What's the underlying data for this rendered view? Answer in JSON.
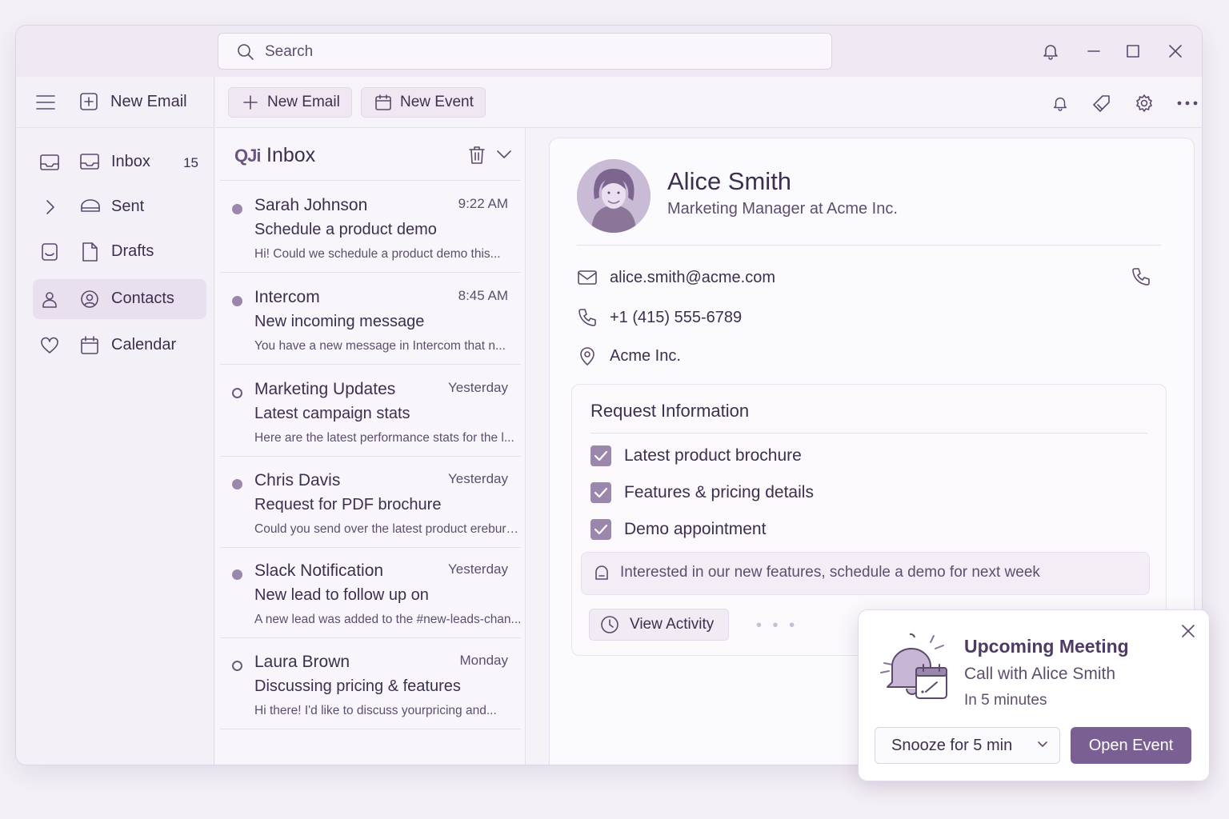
{
  "search": {
    "placeholder": "Search"
  },
  "sidebar": {
    "new_email_label": "New Email",
    "items": [
      {
        "label": "Inbox",
        "count": "15"
      },
      {
        "label": "Sent"
      },
      {
        "label": "Drafts"
      },
      {
        "label": "Contacts"
      },
      {
        "label": "Calendar"
      }
    ]
  },
  "toolbar": {
    "new_email_label": "New Email",
    "new_event_label": "New Event"
  },
  "inbox": {
    "logo": "QJi",
    "title": "Inbox",
    "emails": [
      {
        "sender": "Sarah Johnson",
        "time": "9:22 AM",
        "subject": "Schedule a product demo",
        "preview": "Hi! Could we schedule a product demo this..."
      },
      {
        "sender": "Intercom",
        "time": "8:45 AM",
        "subject": "New incoming message",
        "preview": "You have a new message in Intercom that n..."
      },
      {
        "sender": "Marketing Updates",
        "time": "Yesterday",
        "subject": "Latest campaign stats",
        "preview": "Here are the latest performance stats for the l..."
      },
      {
        "sender": "Chris Davis",
        "time": "Yesterday",
        "subject": "Request for PDF brochure",
        "preview": "Could you send over the latest product erebure..."
      },
      {
        "sender": "Slack Notification",
        "time": "Yesterday",
        "subject": "New lead to follow up on",
        "preview": "A new lead was added to the #new-leads-chan..."
      },
      {
        "sender": "Laura Brown",
        "time": "Monday",
        "subject": "Discussing pricing & features",
        "preview": "Hi there! I'd like to discuss yourpricing and..."
      }
    ]
  },
  "contact": {
    "name": "Alice Smith",
    "role": "Marketing Manager at Acme Inc.",
    "email": "alice.smith@acme.com",
    "phone": "+1 (415) 555-6789",
    "company": "Acme Inc."
  },
  "request": {
    "title": "Request Information",
    "items": [
      "Latest product brochure",
      "Features & pricing details",
      "Demo appointment"
    ],
    "note": "Interested in our new features, schedule a demo for next week",
    "view_activity_label": "View Activity",
    "more": "• • •"
  },
  "notification": {
    "title": "Upcoming Meeting",
    "subtitle": "Call with Alice Smith",
    "time": "In 5 minutes",
    "snooze_label": "Snooze for 5 min",
    "open_label": "Open Event"
  },
  "colors": {
    "accent": "#7a5f93",
    "unread_dot": "#9a87ab",
    "text": "#3d2f4d"
  }
}
